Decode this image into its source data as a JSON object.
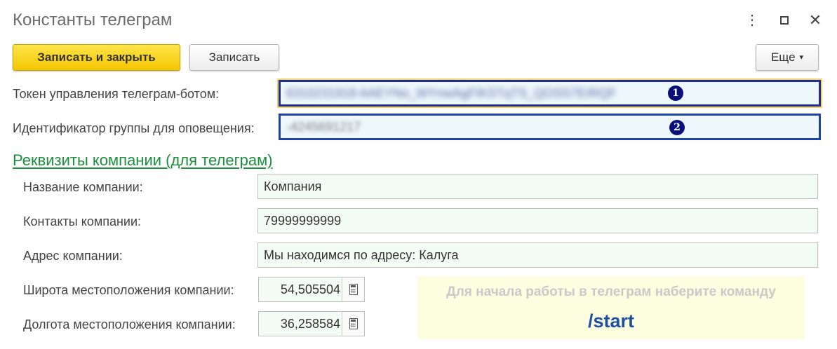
{
  "window": {
    "title": "Константы телеграм",
    "more_glyph": "⋮",
    "close_glyph": "✕"
  },
  "toolbar": {
    "save_close_label": "Записать и закрыть",
    "save_label": "Записать",
    "more_label": "Еще",
    "more_caret": "▾"
  },
  "token": {
    "label": "Токен управления телеграм-ботом:",
    "value": "6310231918 AAEYNo_WYnwAgFIKSTqTS_QOSS7EIRQF",
    "badge": "1"
  },
  "group": {
    "label": "Идентификатор группы для оповещения:",
    "value": "-4245691217",
    "badge": "2"
  },
  "section": {
    "title": "Реквизиты компании (для телеграм)"
  },
  "company": {
    "name_label": "Название компании:",
    "name_value": "Компания",
    "contacts_label": "Контакты компании:",
    "contacts_value": "79999999999",
    "address_label": "Адрес компании:",
    "address_value": "Мы находимся по адресу: Калуга",
    "lat_label": "Широта местоположения компании:",
    "lat_value": "54,505504",
    "lon_label": "Долгота местоположения компании:",
    "lon_value": "36,258584"
  },
  "hint": {
    "text": "Для начала работы в телеграм наберите команду",
    "command": "/start"
  },
  "icons": {
    "calculator": "calculator-icon",
    "kebab": "kebab-menu-icon",
    "maximize": "maximize-icon",
    "close": "close-icon"
  },
  "colors": {
    "primary_button": "#f5cd12",
    "section_title": "#1b8f3c",
    "badge": "#0a0f7a",
    "hint_background": "#fdfde0",
    "hint_command": "#1e4fa0",
    "focused_border": "#1f2f8a"
  }
}
